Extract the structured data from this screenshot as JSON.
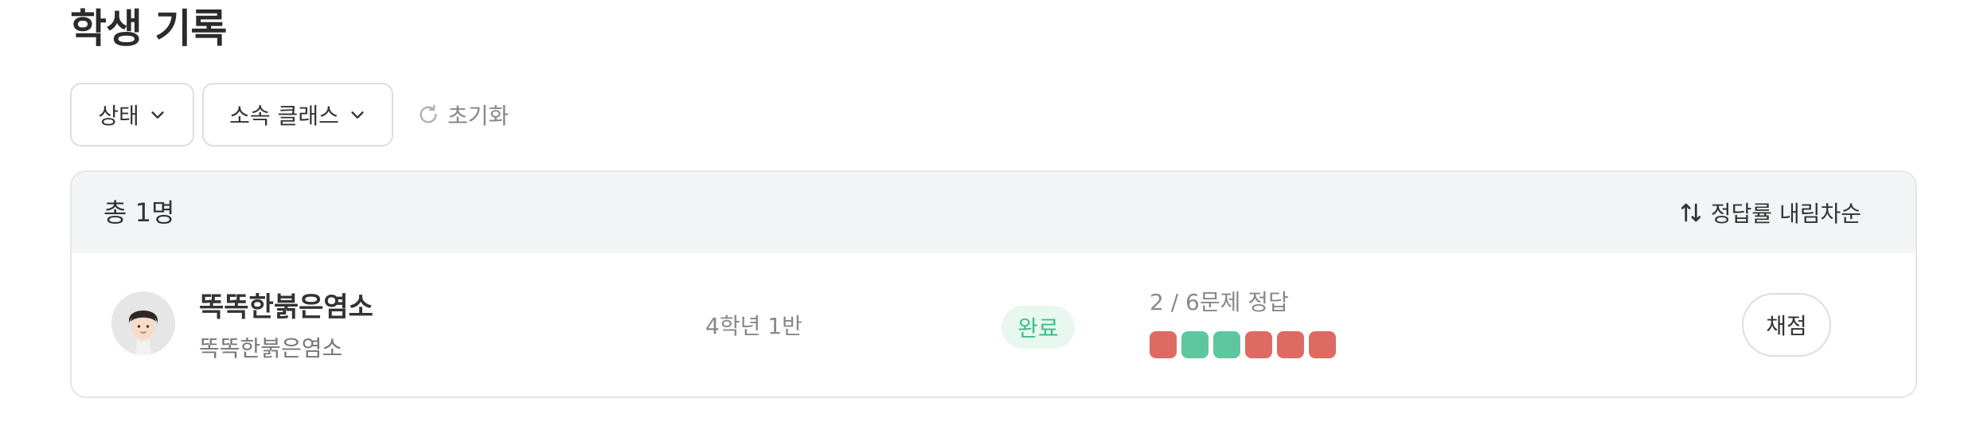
{
  "page": {
    "title": "학생 기록"
  },
  "filters": {
    "status_label": "상태",
    "class_label": "소속 클래스",
    "reset_label": "초기화"
  },
  "table": {
    "total_label": "총 1명",
    "sort_label": "정답률 내림차순",
    "rows": [
      {
        "name": "똑똑한붉은염소",
        "sub_name": "똑똑한붉은염소",
        "class_name": "4학년 1반",
        "status": "완료",
        "result": "2 / 6문제 정답",
        "answers": [
          false,
          true,
          true,
          false,
          false,
          false
        ],
        "grade_label": "채점"
      }
    ]
  },
  "colors": {
    "correct": "#5ec7a0",
    "incorrect": "#de6b62",
    "status_bg": "#e8f7f0",
    "status_text": "#3dbd8c"
  },
  "icons": {
    "filter_chevron": "chevron-down-icon",
    "reset": "refresh-icon",
    "sort": "sort-arrows-icon",
    "avatar": "student-avatar"
  }
}
